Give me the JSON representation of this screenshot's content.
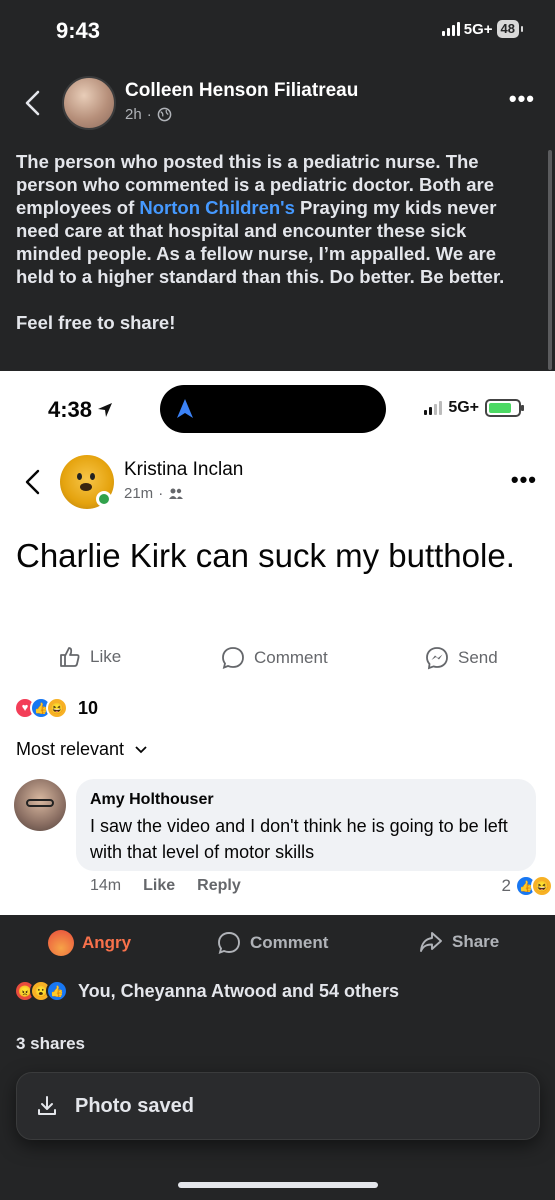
{
  "status_bar": {
    "time": "9:43",
    "network": "5G+",
    "battery": "48"
  },
  "post": {
    "author": "Colleen Henson Filiatreau",
    "time": "2h",
    "text_1": "The person who posted this is a pediatric nurse. The person who commented is a pediatric doctor. Both are employees of ",
    "link": "Norton Children's",
    "text_2": " Praying my kids never need care at that hospital and encounter these sick minded people. As a fellow nurse, I’m appalled. We are held to a higher standard than this. Do better. Be better.",
    "text_3": "Feel free to share!"
  },
  "embed": {
    "status_time": "4:38",
    "network": "5G+",
    "author": "Kristina Inclan",
    "time": "21m",
    "text": "Charlie Kirk can suck my butthole.",
    "actions": {
      "like": "Like",
      "comment": "Comment",
      "send": "Send"
    },
    "reaction_count": "10",
    "sort": "Most relevant",
    "comment": {
      "author": "Amy Holthouser",
      "text": "I saw the video and I don't think he is going to be left with that level of motor skills",
      "time": "14m",
      "like": "Like",
      "reply": "Reply",
      "reaction_count": "2"
    }
  },
  "footer": {
    "angry": "Angry",
    "comment": "Comment",
    "share": "Share",
    "reactions_text": "You, Cheyanna Atwood and 54 others",
    "shares": "3 shares"
  },
  "toast": {
    "text": "Photo saved"
  },
  "colors": {
    "link": "#4599ff",
    "angry": "#f7714b",
    "fb_blue": "#1877f2",
    "online": "#31a24c"
  }
}
